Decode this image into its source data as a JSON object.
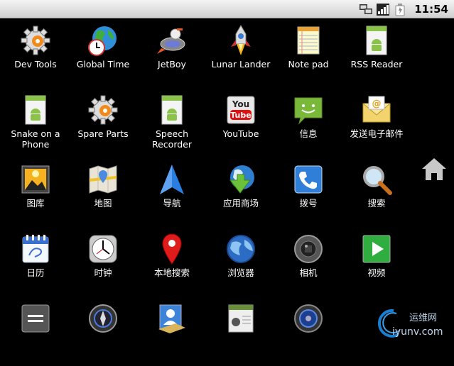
{
  "status": {
    "time": "11:54"
  },
  "apps": [
    {
      "label": "Dev Tools",
      "icon": "gear-icon"
    },
    {
      "label": "Global Time",
      "icon": "globe-clock-icon"
    },
    {
      "label": "JetBoy",
      "icon": "rocket-icon"
    },
    {
      "label": "Lunar Lander",
      "icon": "lander-icon"
    },
    {
      "label": "Note pad",
      "icon": "notepad-icon"
    },
    {
      "label": "RSS Reader",
      "icon": "android-doc-icon"
    },
    {
      "label": "Snake on a Phone",
      "icon": "android-doc-icon"
    },
    {
      "label": "Spare Parts",
      "icon": "gear-icon"
    },
    {
      "label": "Speech Recorder",
      "icon": "android-doc-icon"
    },
    {
      "label": "YouTube",
      "icon": "youtube-icon"
    },
    {
      "label": "信息",
      "icon": "message-icon"
    },
    {
      "label": "发送电子邮件",
      "icon": "email-icon"
    },
    {
      "label": "图库",
      "icon": "gallery-icon"
    },
    {
      "label": "地图",
      "icon": "map-icon"
    },
    {
      "label": "导航",
      "icon": "navigation-icon"
    },
    {
      "label": "应用商场",
      "icon": "market-icon"
    },
    {
      "label": "拨号",
      "icon": "phone-icon"
    },
    {
      "label": "搜索",
      "icon": "search-icon"
    },
    {
      "label": "日历",
      "icon": "calendar-icon"
    },
    {
      "label": "时钟",
      "icon": "clock-icon"
    },
    {
      "label": "本地搜索",
      "icon": "map-pin-icon"
    },
    {
      "label": "浏览器",
      "icon": "browser-globe-icon"
    },
    {
      "label": "相机",
      "icon": "camera-icon"
    },
    {
      "label": "视频",
      "icon": "video-icon"
    },
    {
      "label": "",
      "icon": "calculator-icon"
    },
    {
      "label": "",
      "icon": "compass-icon"
    },
    {
      "label": "",
      "icon": "contacts-icon"
    },
    {
      "label": "",
      "icon": "android-doc-icon"
    },
    {
      "label": "",
      "icon": "speaker-icon"
    }
  ],
  "watermark": {
    "label": "运维网",
    "domain": "iyunv.com"
  }
}
